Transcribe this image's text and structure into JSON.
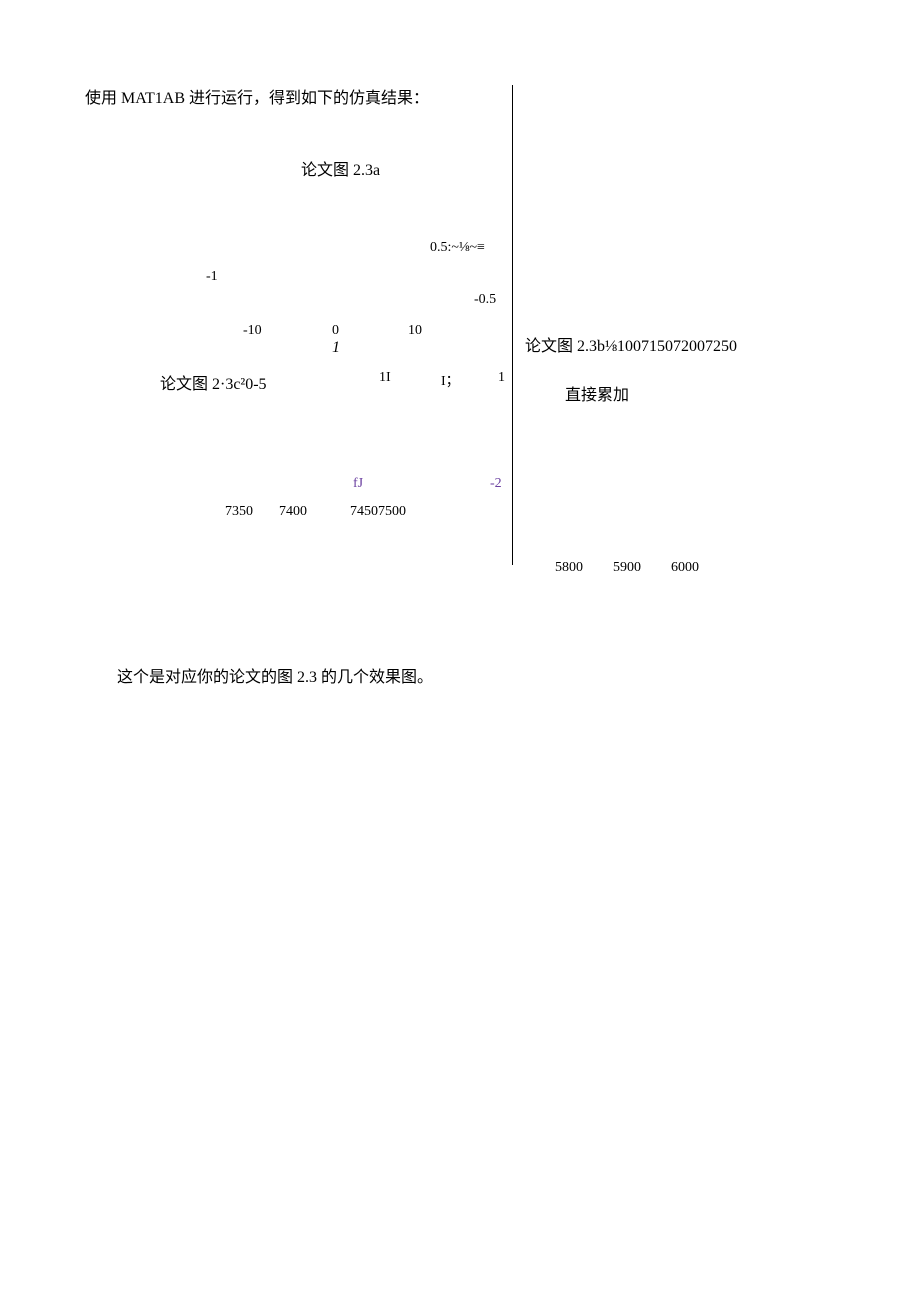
{
  "intro": "使用 MAT1AB 进行运行，得到如下的仿真结果：",
  "labels": {
    "title_a": "论文图 2.3a",
    "y_05": "0.5:~⅛~≡",
    "y_neg1": "-1",
    "y_neg05": "-0.5",
    "x_neg10": "-10",
    "x_0": "0",
    "x_10": "10",
    "axis_1": "1",
    "title_c": "论文图 2·3c²0-5",
    "mark_1I": "1I",
    "mark_I": "I；",
    "mark_1": "1",
    "mark_fJ": "fJ",
    "mark_neg2": "-2",
    "x_7350": "7350",
    "x_7400": "7400",
    "x_74507500": "74507500",
    "title_b": "论文图 2.3b⅛100715072007250",
    "legend_b": "直接累加",
    "x_5800": "5800",
    "x_5900": "5900",
    "x_6000": "6000"
  },
  "conclusion": "这个是对应你的论文的图 2.3 的几个效果图。",
  "chart_data": [
    {
      "type": "line",
      "title": "论文图 2.3a",
      "x_ticks": [
        -10,
        0,
        10
      ],
      "y_ticks": [
        -1,
        -0.5,
        0.5
      ],
      "xlabel": "1",
      "ylabel": "",
      "series": []
    },
    {
      "type": "line",
      "title": "论文图 2.3b⅛100715072007250",
      "legend": [
        "直接累加"
      ],
      "x_ticks": [
        5800,
        5900,
        6000
      ],
      "series": []
    },
    {
      "type": "line",
      "title": "论文图 2·3c²0-5",
      "x_ticks": [
        7350,
        7400,
        7450,
        7500
      ],
      "y_ticks": [
        -2
      ],
      "annotations": [
        "1I",
        "I；",
        "1",
        "fJ"
      ],
      "series": []
    }
  ]
}
